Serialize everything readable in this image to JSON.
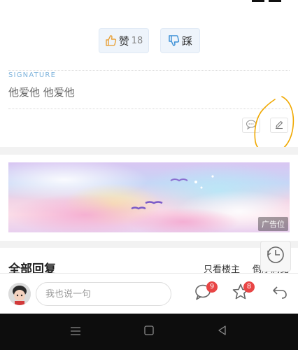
{
  "post": {
    "like_label": "赞",
    "like_count": "18",
    "dislike_label": "踩"
  },
  "signature": {
    "heading": "SIGNATURE",
    "text": "他爱他 他爱他"
  },
  "ad": {
    "badge": "广告位"
  },
  "replies": {
    "title": "全部回复",
    "only_op": "只看楼主",
    "reverse_order": "倒序浏览"
  },
  "action_bar": {
    "input_placeholder": "我也说一句",
    "comment_count": "9",
    "favorite_count": "8"
  },
  "colors": {
    "accent_blue": "#7fb4dc",
    "badge_red": "#e84545",
    "annotation_orange": "#f0a800",
    "like_icon": "#e8a23a",
    "dislike_icon": "#3a8fd6"
  },
  "icons": [
    "thumbs-up-icon",
    "thumbs-down-icon",
    "comment-bubble-icon",
    "edit-pencil-icon",
    "history-clock-icon",
    "chat-icon",
    "star-icon",
    "back-arrow-icon",
    "menu-icon",
    "home-icon",
    "back-triangle-icon"
  ]
}
